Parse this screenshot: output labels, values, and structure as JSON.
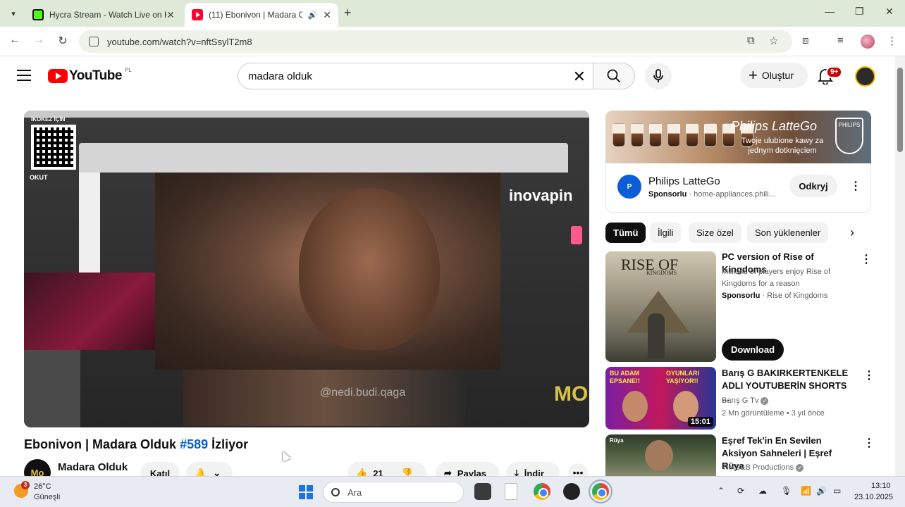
{
  "browser": {
    "tabs": [
      {
        "title": "Hycra Stream - Watch Live on K",
        "favicon": "kick-icon",
        "active": false
      },
      {
        "title": "(11) Ebonivon | Madara Old",
        "favicon": "youtube-icon",
        "active": true
      }
    ],
    "url": "youtube.com/watch?v=nftSsylT2m8"
  },
  "youtube": {
    "logo_text": "YouTube",
    "country_code": "PL",
    "search_value": "madara olduk",
    "create_label": "Oluştur",
    "notifications_badge": "9+"
  },
  "player": {
    "qr_label_top": "İKOKEZ İÇİN",
    "qr_label_bottom": "OKUT",
    "sponsor_logo": "inovapin",
    "watermark": "@nedi.budi.qaga",
    "corner_logo": "MO"
  },
  "video": {
    "title": "Ebonivon | Madara Olduk",
    "hashtag": "#589",
    "title_suffix": "İzliyor",
    "channel_name": "Madara Olduk",
    "channel_avatar_text": "Mo",
    "join_label": "Katıl",
    "like_count": "21",
    "share_label": "Paylaş",
    "download_label": "İndir"
  },
  "ad": {
    "banner_brand": "Philips LatteGo",
    "banner_sub": "Twoje ulubione kawy za jednym dotknięciem",
    "banner_shield": "PHILIPS",
    "advertiser": "Philips LatteGo",
    "sponsored": "Sponsorlu",
    "domain": "home-appliances.phili...",
    "cta": "Odkryj"
  },
  "chips": [
    "Tümü",
    "İlgili",
    "Size özel",
    "Son yüklenenler"
  ],
  "recommendations": [
    {
      "title": "PC version of Rise of Kingdoms",
      "desc": "Millions of players enjoy Rise of Kingdoms for a reason",
      "sponsored": "Sponsorlu",
      "channel": "Rise of Kingdoms",
      "thumb_title": "RISE OF",
      "thumb_sub": "KINGDOMS",
      "button": "Download"
    },
    {
      "title": "Barış G BAKIRKERTENKELE ADLI YOUTUBERİN SHORTS ...",
      "channel": "Barış G Tv",
      "meta": "2 Mn görüntüleme • 3 yıl önce",
      "duration": "15:01",
      "thumb_left": "BU ADAM EPSANE!!",
      "thumb_right": "OYUNLARI YAŞIYOR!!"
    },
    {
      "title": "Eşref Tek'in En Sevilen Aksiyon Sahneleri | Eşref Rüya",
      "channel": "TIMS&B Productions",
      "thumb_tag": "Rüya"
    }
  ],
  "taskbar": {
    "temperature": "26°C",
    "weather": "Güneşli",
    "weather_badge": "3",
    "search_placeholder": "Ara",
    "time": "13:10",
    "date": "23.10.2025"
  }
}
